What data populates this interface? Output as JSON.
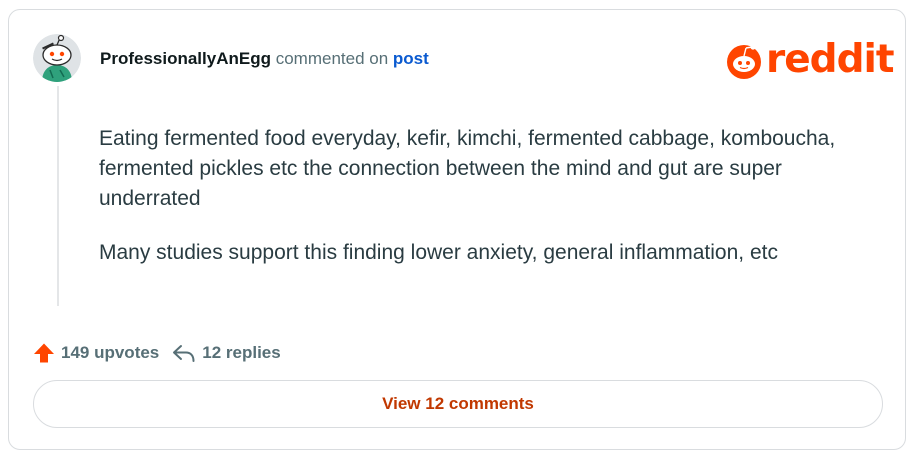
{
  "comment": {
    "username": "ProfessionallyAnEgg",
    "commented_on_text": " commented on ",
    "post_link_label": "post",
    "avatar_icon": "snoo-avatar-icon",
    "paragraphs": [
      "Eating fermented food everyday, kefir, kimchi, fermented cabbage, komboucha, fermented pickles etc the connection between the mind and gut are super underrated",
      "Many studies support this finding lower anxiety, general inflammation, etc"
    ]
  },
  "brand": {
    "logo_text": "reddit",
    "logo_icon": "reddit-snoo-icon",
    "color": "#ff4500"
  },
  "actions": {
    "upvote_icon": "upvote-arrow-icon",
    "upvotes_label": "149 upvotes",
    "reply_icon": "reply-arrow-icon",
    "replies_label": "12 replies"
  },
  "footer": {
    "view_comments_label": "View 12 comments"
  }
}
